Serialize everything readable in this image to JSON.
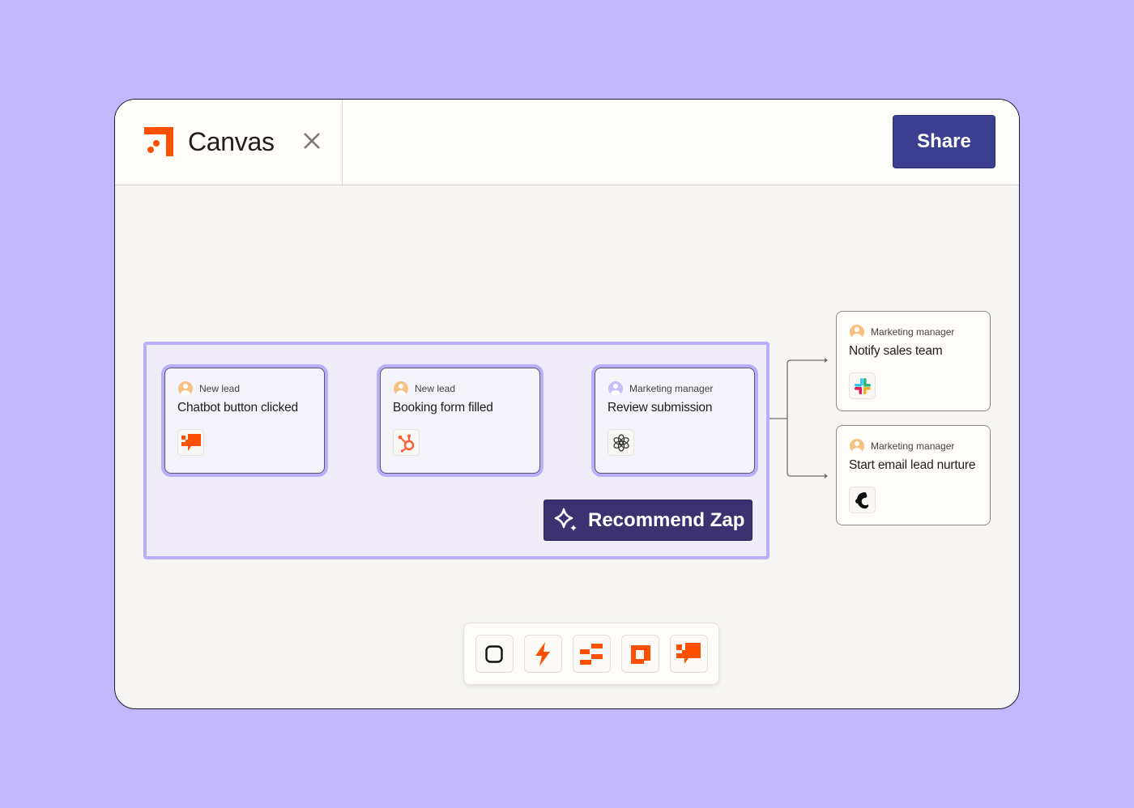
{
  "header": {
    "app_title": "Canvas",
    "close_label": "Close",
    "share_label": "Share"
  },
  "colors": {
    "background": "#c3b8fe",
    "brand_orange": "#ff4f00",
    "share_button": "#3b3f8f",
    "recommend_button": "#3d3270",
    "group_border": "#b9aefc"
  },
  "group": {
    "nodes": [
      {
        "role": "New lead",
        "title": "Chatbot button clicked",
        "icon": "chatbot-icon",
        "avatar": "orange"
      },
      {
        "role": "New lead",
        "title": "Booking form filled",
        "icon": "hubspot-icon",
        "avatar": "orange"
      },
      {
        "role": "Marketing manager",
        "title": "Review submission",
        "icon": "openai-icon",
        "avatar": "purple"
      }
    ],
    "recommend_label": "Recommend Zap"
  },
  "outputs": [
    {
      "role": "Marketing manager",
      "title": "Notify sales team",
      "icon": "slack-icon"
    },
    {
      "role": "Marketing manager",
      "title": "Start email lead nurture",
      "icon": "mailchimp-icon"
    }
  ],
  "toolbar": {
    "tools": [
      {
        "name": "shape-tool",
        "icon": "rounded-square-icon"
      },
      {
        "name": "zap-tool",
        "icon": "lightning-icon"
      },
      {
        "name": "tables-tool",
        "icon": "tables-icon"
      },
      {
        "name": "interfaces-tool",
        "icon": "interfaces-icon"
      },
      {
        "name": "chatbot-tool",
        "icon": "chatbot-icon"
      }
    ]
  }
}
